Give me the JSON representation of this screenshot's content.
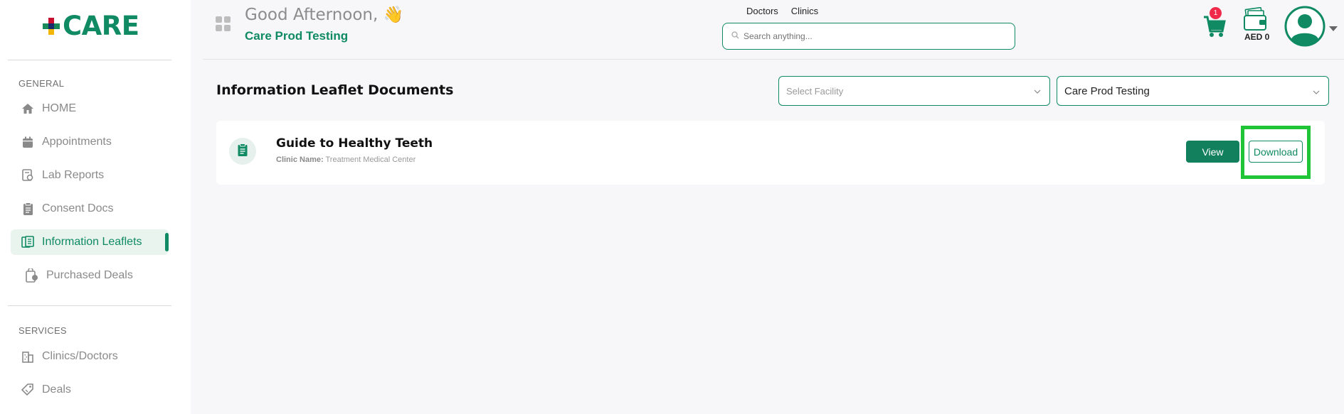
{
  "app": {
    "logo_text": "CARE"
  },
  "sidebar": {
    "general_label": "GENERAL",
    "services_label": "SERVICES",
    "general_items": [
      {
        "label": "HOME",
        "icon": "home-icon"
      },
      {
        "label": "Appointments",
        "icon": "calendar-icon"
      },
      {
        "label": "Lab Reports",
        "icon": "lab-report-icon"
      },
      {
        "label": "Consent Docs",
        "icon": "clipboard-icon"
      },
      {
        "label": "Information Leaflets",
        "icon": "leaflet-icon",
        "active": true
      },
      {
        "label": "Purchased Deals",
        "icon": "purchased-deals-icon"
      }
    ],
    "service_items": [
      {
        "label": "Clinics/Doctors",
        "icon": "building-icon"
      },
      {
        "label": "Deals",
        "icon": "tag-icon"
      }
    ]
  },
  "header": {
    "greeting": "Good Afternoon,",
    "greeting_emoji": "👋",
    "user_name": "Care Prod Testing",
    "tabs": [
      "Doctors",
      "Clinics"
    ],
    "search_placeholder": "Search anything...",
    "cart_count": "1",
    "wallet_amount": "AED 0"
  },
  "main": {
    "title": "Information Leaflet Documents",
    "facility_select": {
      "placeholder": "Select Facility"
    },
    "clinic_select": {
      "value": "Care Prod Testing"
    },
    "documents": [
      {
        "title": "Guide to Healthy Teeth",
        "clinic_label": "Clinic Name:",
        "clinic_name": "Treatment Medical Center",
        "view_label": "View",
        "download_label": "Download"
      }
    ]
  },
  "colors": {
    "brand_green": "#0f8a63",
    "highlight_green": "#1fc437",
    "badge_red": "#f0284a"
  }
}
